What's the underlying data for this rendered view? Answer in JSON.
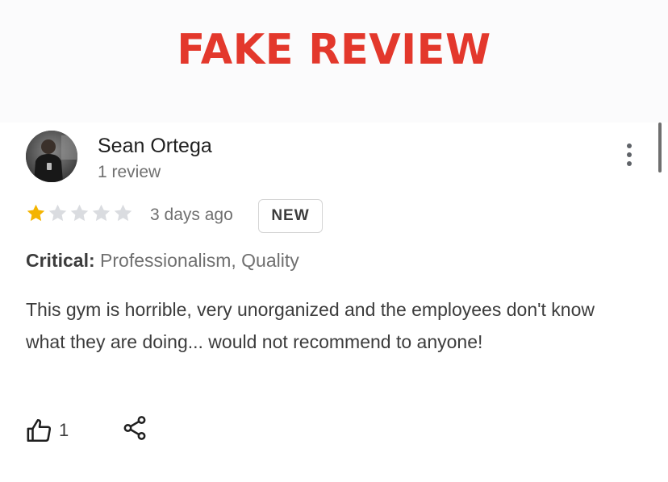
{
  "banner": {
    "title": "FAKE REVIEW",
    "color": "#e3382c"
  },
  "review": {
    "author": {
      "name": "Sean Ortega",
      "meta": "1 review",
      "avatar_icon": "user-photo"
    },
    "rating": {
      "value": 1,
      "max": 5,
      "filled_color": "#f4b400",
      "empty_color": "#dadce0"
    },
    "time": "3 days ago",
    "badge": "NEW",
    "critical": {
      "label": "Critical:",
      "value": "Professionalism, Quality"
    },
    "text": "This gym is horrible, very unorganized and the employees don't know what they are doing... would not recommend to anyone!",
    "actions": {
      "like_count": "1",
      "like_icon": "thumbs-up-icon",
      "share_icon": "share-icon",
      "more_icon": "more-vertical-icon"
    }
  }
}
